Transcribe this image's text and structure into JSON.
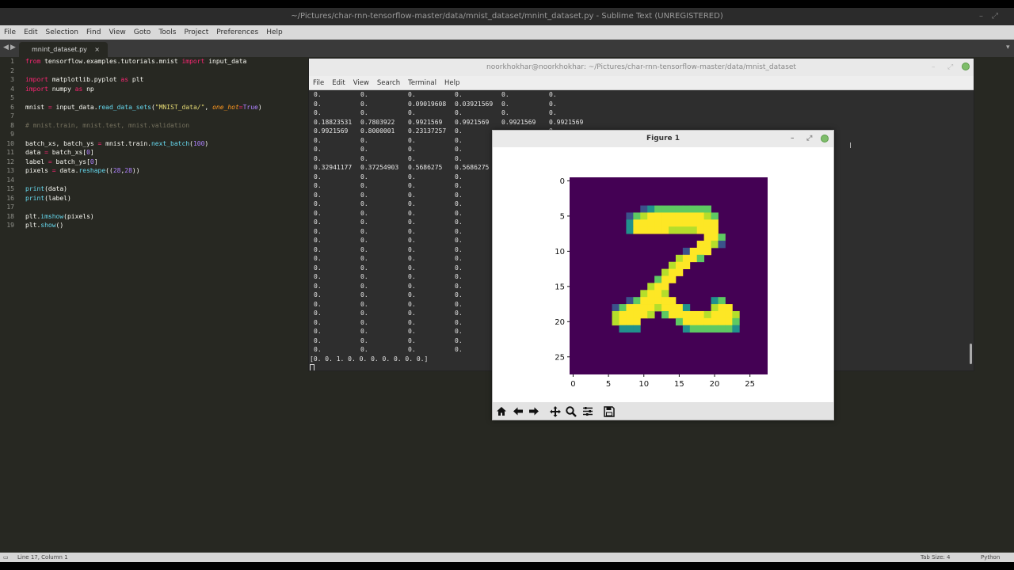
{
  "sublime": {
    "title": "~/Pictures/char-rnn-tensorflow-master/data/mnist_dataset/mnint_dataset.py - Sublime Text (UNREGISTERED)",
    "menu": [
      "File",
      "Edit",
      "Selection",
      "Find",
      "View",
      "Goto",
      "Tools",
      "Project",
      "Preferences",
      "Help"
    ],
    "tab_label": "mnint_dataset.py",
    "tab_close": "×",
    "status_left": "Line 17, Column 1",
    "status_tab_size": "Tab Size: 4",
    "status_syntax": "Python",
    "line_numbers": [
      "1",
      "2",
      "3",
      "4",
      "5",
      "6",
      "7",
      "8",
      "9",
      "10",
      "11",
      "12",
      "13",
      "14",
      "15",
      "16",
      "17",
      "18",
      "19"
    ]
  },
  "terminal": {
    "title": "noorkhokhar@noorkhokhar: ~/Pictures/char-rnn-tensorflow-master/data/mnist_dataset",
    "menu": [
      "File",
      "Edit",
      "View",
      "Search",
      "Terminal",
      "Help"
    ],
    "rows": [
      [
        "0.",
        "0.",
        "0.",
        "0.",
        "0.",
        "0."
      ],
      [
        "0.",
        "0.",
        "0.09019608",
        "0.03921569",
        "0.",
        "0."
      ],
      [
        "0.",
        "0.",
        "0.",
        "0.",
        "0.",
        "0."
      ],
      [
        "0.18823531",
        "0.7803922",
        "0.9921569",
        "0.9921569",
        "0.9921569",
        "0.9921569"
      ],
      [
        "0.9921569",
        "0.8000001",
        "0.23137257",
        "0.",
        "",
        "0."
      ],
      [
        "0.",
        "0.",
        "0.",
        "0.",
        "",
        ""
      ],
      [
        "0.",
        "0.",
        "0.",
        "0.",
        "",
        ""
      ],
      [
        "0.",
        "0.",
        "0.",
        "0.",
        "",
        ""
      ],
      [
        "0.32941177",
        "0.37254903",
        "0.5686275",
        "0.5686275",
        "",
        ""
      ],
      [
        "0.",
        "0.",
        "0.",
        "0.",
        "",
        ""
      ],
      [
        "0.",
        "0.",
        "0.",
        "0.",
        "",
        ""
      ],
      [
        "0.",
        "0.",
        "0.",
        "0.",
        "",
        ""
      ],
      [
        "0.",
        "0.",
        "0.",
        "0.",
        "",
        ""
      ],
      [
        "0.",
        "0.",
        "0.",
        "0.",
        "",
        ""
      ],
      [
        "0.",
        "0.",
        "0.",
        "0.",
        "",
        ""
      ],
      [
        "0.",
        "0.",
        "0.",
        "0.",
        "",
        ""
      ],
      [
        "0.",
        "0.",
        "0.",
        "0.",
        "",
        ""
      ],
      [
        "0.",
        "0.",
        "0.",
        "0.",
        "",
        ""
      ],
      [
        "0.",
        "0.",
        "0.",
        "0.",
        "",
        ""
      ],
      [
        "0.",
        "0.",
        "0.",
        "0.",
        "",
        ""
      ],
      [
        "0.",
        "0.",
        "0.",
        "0.",
        "",
        ""
      ],
      [
        "0.",
        "0.",
        "0.",
        "0.",
        "",
        ""
      ],
      [
        "0.",
        "0.",
        "0.",
        "0.",
        "",
        ""
      ],
      [
        "0.",
        "0.",
        "0.",
        "0.",
        "",
        ""
      ],
      [
        "0.",
        "0.",
        "0.",
        "0.",
        "",
        ""
      ],
      [
        "0.",
        "0.",
        "0.",
        "0.",
        "",
        ""
      ],
      [
        "0.",
        "0.",
        "0.",
        "0.",
        "",
        ""
      ],
      [
        "0.",
        "0.",
        "0.",
        "0.",
        "",
        ""
      ],
      [
        "0.",
        "0.",
        "0.",
        "0.",
        "",
        ""
      ]
    ],
    "label_line": "[0. 0. 1. 0. 0. 0. 0. 0. 0. 0.]"
  },
  "figure": {
    "title": "Figure 1",
    "y_ticks": [
      "0",
      "5",
      "10",
      "15",
      "20",
      "25"
    ],
    "x_ticks": [
      "0",
      "5",
      "10",
      "15",
      "20",
      "25"
    ],
    "toolbar_icons": [
      "home-icon",
      "back-arrow-icon",
      "forward-arrow-icon",
      "pan-icon",
      "zoom-icon",
      "configure-icon",
      "save-icon"
    ]
  },
  "chart_data": {
    "type": "heatmap",
    "title": "",
    "xlabel": "",
    "ylabel": "",
    "xlim": [
      0,
      27
    ],
    "ylim": [
      27,
      0
    ],
    "colormap": "viridis",
    "background": "#440154",
    "colors": {
      "low": "#440154",
      "mid_low": "#3b528b",
      "mid": "#21918c",
      "mid_high": "#5ec962",
      "high": "#fde725"
    },
    "grid_rows": [
      "............................",
      "............................",
      "............................",
      "............................",
      "..........1233333333........",
      "........1345555555543.......",
      "........2555555555555.......",
      "........2555554444555.......",
      "...................553......",
      "..................5541......",
      "................1555........",
      "...............4553.........",
      "..............455...........",
      ".............455............",
      "............355.............",
      "...........455..............",
      "..........4554..............",
      "........1355555.....23......",
      "......13555545552...455.....",
      "......455554.35555545554....",
      "......4555.....355555553....",
      ".......222......23333332....",
      "............................",
      "............................",
      "............................",
      "............................",
      "............................",
      "............................"
    ]
  }
}
